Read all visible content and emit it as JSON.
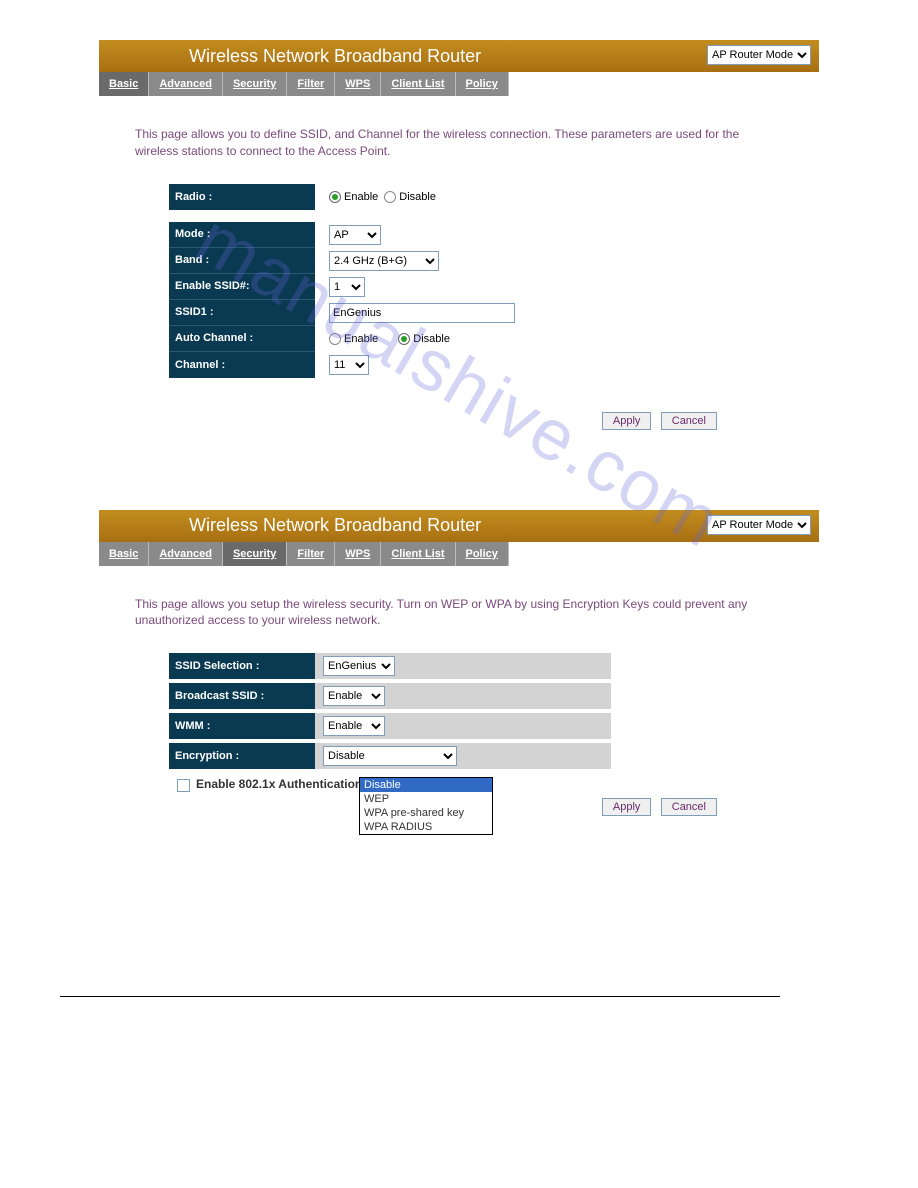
{
  "watermark": "manualshive.com",
  "panel1": {
    "title": "Wireless Network Broadband Router",
    "mode_select": "AP Router Mode",
    "tabs": [
      "Basic",
      "Advanced",
      "Security",
      "Filter",
      "WPS",
      "Client List",
      "Policy"
    ],
    "active_tab": "Basic",
    "intro": "This page allows you to define SSID, and Channel for the wireless connection. These parameters are used for the wireless stations to connect to the Access Point.",
    "rows": {
      "radio_label": "Radio :",
      "radio_enable": "Enable",
      "radio_disable": "Disable",
      "mode_label": "Mode :",
      "mode_value": "AP",
      "band_label": "Band :",
      "band_value": "2.4 GHz (B+G)",
      "enable_ssid_label": "Enable SSID#:",
      "enable_ssid_value": "1",
      "ssid1_label": "SSID1 :",
      "ssid1_value": "EnGenius",
      "auto_ch_label": "Auto Channel :",
      "auto_ch_enable": "Enable",
      "auto_ch_disable": "Disable",
      "channel_label": "Channel :",
      "channel_value": "11"
    },
    "buttons": {
      "apply": "Apply",
      "cancel": "Cancel"
    }
  },
  "panel2": {
    "title": "Wireless Network Broadband Router",
    "mode_select": "AP Router Mode",
    "tabs": [
      "Basic",
      "Advanced",
      "Security",
      "Filter",
      "WPS",
      "Client List",
      "Policy"
    ],
    "active_tab": "Security",
    "intro": "This page allows you setup the wireless security. Turn on WEP or WPA by using Encryption Keys could prevent any unauthorized access to your wireless network.",
    "rows": {
      "ssid_sel_label": "SSID Selection :",
      "ssid_sel_value": "EnGenius",
      "broadcast_label": "Broadcast SSID :",
      "broadcast_value": "Enable",
      "wmm_label": "WMM :",
      "wmm_value": "Enable",
      "encryption_label": "Encryption :",
      "encryption_value": "Disable"
    },
    "checkbox_label": "Enable 802.1x Authentication",
    "encryption_options": [
      "Disable",
      "WEP",
      "WPA pre-shared key",
      "WPA RADIUS"
    ],
    "buttons": {
      "apply": "Apply",
      "cancel": "Cancel"
    }
  }
}
